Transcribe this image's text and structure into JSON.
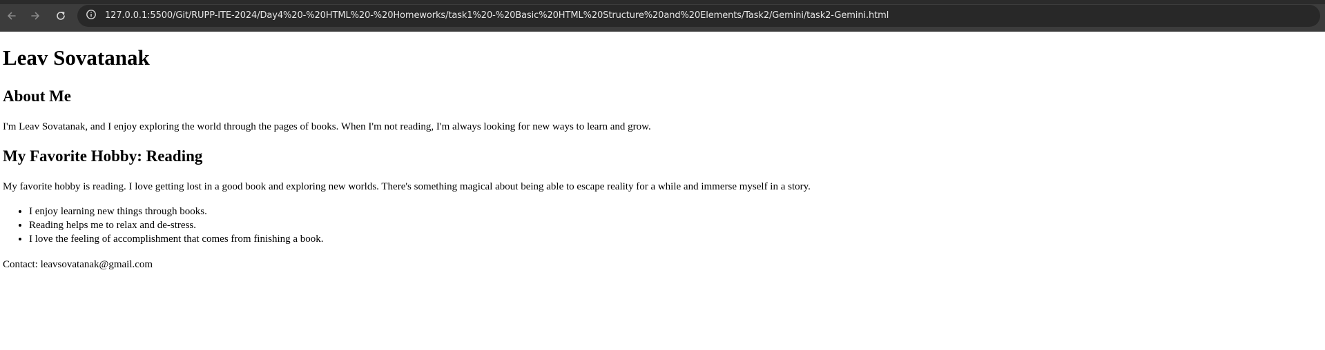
{
  "browser": {
    "url": "127.0.0.1:5500/Git/RUPP-ITE-2024/Day4%20-%20HTML%20-%20Homeworks/task1%20-%20Basic%20HTML%20Structure%20and%20Elements/Task2/Gemini/task2-Gemini.html",
    "icons": {
      "back": "arrow-left-icon",
      "forward": "arrow-right-icon",
      "reload": "reload-icon",
      "site_info": "info-icon"
    }
  },
  "page": {
    "title": "Leav Sovatanak",
    "about": {
      "heading": "About Me",
      "text": "I'm Leav Sovatanak, and I enjoy exploring the world through the pages of books. When I'm not reading, I'm always looking for new ways to learn and grow."
    },
    "hobby": {
      "heading": "My Favorite Hobby: Reading",
      "text": "My favorite hobby is reading. I love getting lost in a good book and exploring new worlds. There's something magical about being able to escape reality for a while and immerse myself in a story.",
      "items": [
        "I enjoy learning new things through books.",
        "Reading helps me to relax and de-stress.",
        "I love the feeling of accomplishment that comes from finishing a book."
      ]
    },
    "contact": "Contact: leavsovatanak@gmail.com"
  }
}
